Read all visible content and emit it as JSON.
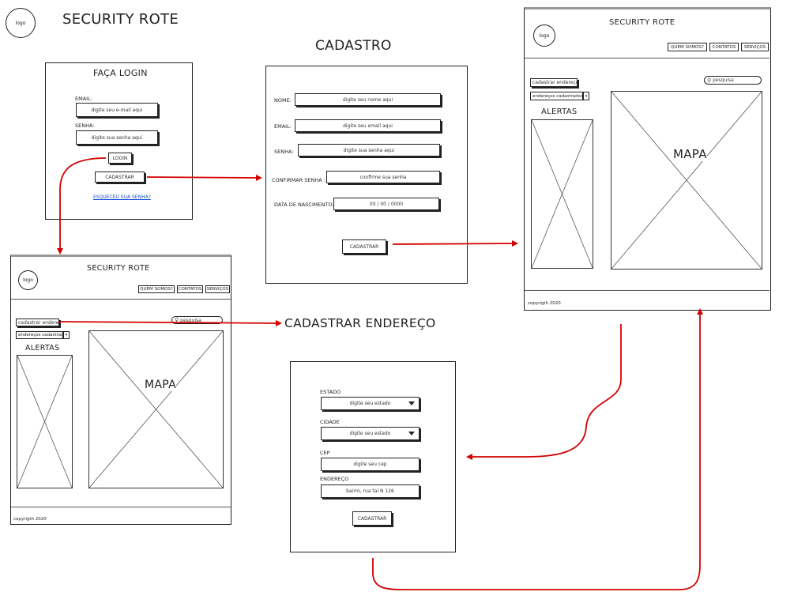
{
  "header": {
    "logo_label": "logo",
    "title": "SECURITY ROTE"
  },
  "login": {
    "title": "FAÇA LOGIN",
    "email_label": "EMAIL:",
    "email_placeholder": "digite seu e-mail aqui",
    "password_label": "SENHA:",
    "password_placeholder": "digite sua senha aqui",
    "login_button": "LOGIN",
    "register_button": "CADASTRAR",
    "forgot_link": "ESQUECEU SUA SENHA?"
  },
  "cadastro": {
    "heading": "CADASTRO",
    "fields": [
      {
        "label": "NOME:",
        "placeholder": "digite seu nome aqui"
      },
      {
        "label": "EMAIL:",
        "placeholder": "digite seu email aqui"
      },
      {
        "label": "SENHA:",
        "placeholder": "digite sua senha aqui"
      },
      {
        "label": "CONFIRMAR SENHA :",
        "placeholder": "confirme sua senha"
      },
      {
        "label": "DATA DE NASCIMENTO:",
        "placeholder": "00 / 00 / 0000"
      }
    ],
    "submit_button": "CADASTRAR"
  },
  "dashboard": {
    "logo_label": "logo",
    "title": "SECURITY ROTE",
    "nav": [
      "QUEM SOMOS?",
      "CONTATOS",
      "SERVIÇOS"
    ],
    "register_address_button": "cadastrar endereço",
    "addresses_select": "endereços cadastrados",
    "search_placeholder": "pesquisa",
    "alerts_title": "ALERTAS",
    "map_label": "MAPA",
    "footer": "copyrigth 2020"
  },
  "endereco": {
    "heading": "CADASTRAR ENDEREÇO",
    "state_label": "ESTADO",
    "state_placeholder": "digite seu estado",
    "city_label": "CIDADE",
    "city_placeholder": "digite seu estado",
    "cep_label": "CEP",
    "cep_placeholder": "digite seu cep",
    "address_label": "ENDEREÇO",
    "address_placeholder": "bairro, rua tal N 126",
    "submit_button": "CADASTRAR"
  },
  "colors": {
    "arrow": "#d40000",
    "ink": "#222222",
    "link": "#1a4fd6"
  }
}
